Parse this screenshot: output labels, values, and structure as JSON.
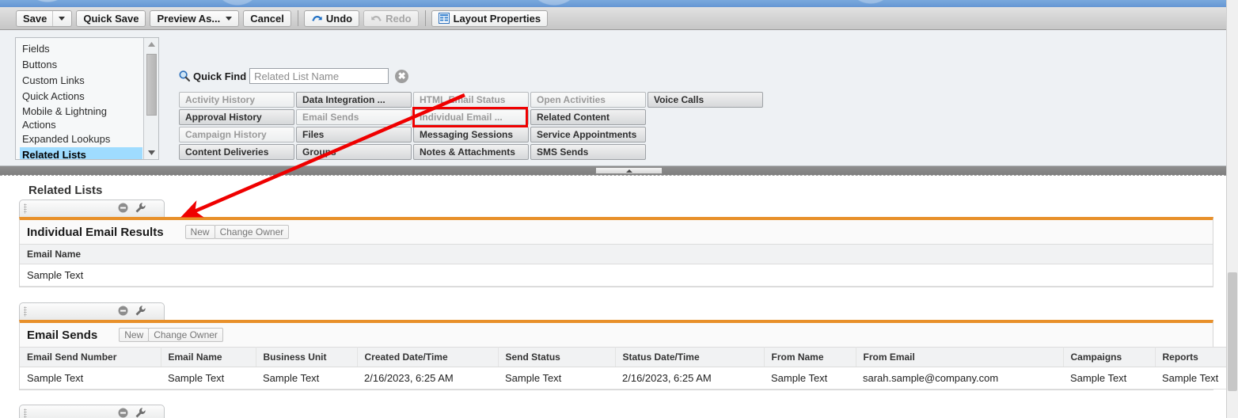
{
  "toolbar": {
    "save_label": "Save",
    "quick_save_label": "Quick Save",
    "preview_as_label": "Preview As...",
    "cancel_label": "Cancel",
    "undo_label": "Undo",
    "redo_label": "Redo",
    "layout_properties_label": "Layout Properties"
  },
  "sidebar": {
    "items": [
      {
        "label": "Fields",
        "selected": false
      },
      {
        "label": "Buttons",
        "selected": false
      },
      {
        "label": "Custom Links",
        "selected": false
      },
      {
        "label": "Quick Actions",
        "selected": false
      },
      {
        "label": "Mobile & Lightning Actions",
        "selected": false
      },
      {
        "label": "Expanded Lookups",
        "selected": false
      },
      {
        "label": "Related Lists",
        "selected": true
      }
    ]
  },
  "quick_find": {
    "label": "Quick Find",
    "placeholder": "Related List Name",
    "value": "",
    "clear_glyph": "✖"
  },
  "palette": {
    "columns": [
      [
        {
          "label": "Activity History",
          "used": true
        },
        {
          "label": "Approval History",
          "used": false
        },
        {
          "label": "Campaign History",
          "used": true
        },
        {
          "label": "Content Deliveries",
          "used": false
        }
      ],
      [
        {
          "label": "Data Integration ...",
          "used": false
        },
        {
          "label": "Email Sends",
          "used": true
        },
        {
          "label": "Files",
          "used": false
        },
        {
          "label": "Groups",
          "used": false
        }
      ],
      [
        {
          "label": "HTML Email Status",
          "used": true
        },
        {
          "label": "Individual Email ...",
          "used": true,
          "highlighted": true
        },
        {
          "label": "Messaging Sessions",
          "used": false
        },
        {
          "label": "Notes & Attachments",
          "used": false
        }
      ],
      [
        {
          "label": "Open Activities",
          "used": true
        },
        {
          "label": "Related Content",
          "used": false
        },
        {
          "label": "Service Appointments",
          "used": false
        },
        {
          "label": "SMS Sends",
          "used": false
        }
      ],
      [
        {
          "label": "Voice Calls",
          "used": false
        }
      ]
    ],
    "highlight_color": "#ef0000"
  },
  "preview": {
    "section_title": "Related Lists",
    "accent_color": "#e8902a",
    "related_lists": [
      {
        "name": "Individual Email Results",
        "actions": [
          "New",
          "Change Owner"
        ],
        "columns": [
          "Email Name"
        ],
        "rows": [
          [
            "Sample Text"
          ]
        ]
      },
      {
        "name": "Email Sends",
        "actions": [
          "New",
          "Change Owner"
        ],
        "columns": [
          "Email Send Number",
          "Email Name",
          "Business Unit",
          "Created Date/Time",
          "Send Status",
          "Status Date/Time",
          "From Name",
          "From Email",
          "Campaigns",
          "Reports"
        ],
        "rows": [
          [
            "Sample Text",
            "Sample Text",
            "Sample Text",
            "2/16/2023, 6:25 AM",
            "Sample Text",
            "2/16/2023, 6:25 AM",
            "Sample Text",
            "sarah.sample@company.com",
            "Sample Text",
            "Sample Text"
          ]
        ]
      }
    ]
  }
}
